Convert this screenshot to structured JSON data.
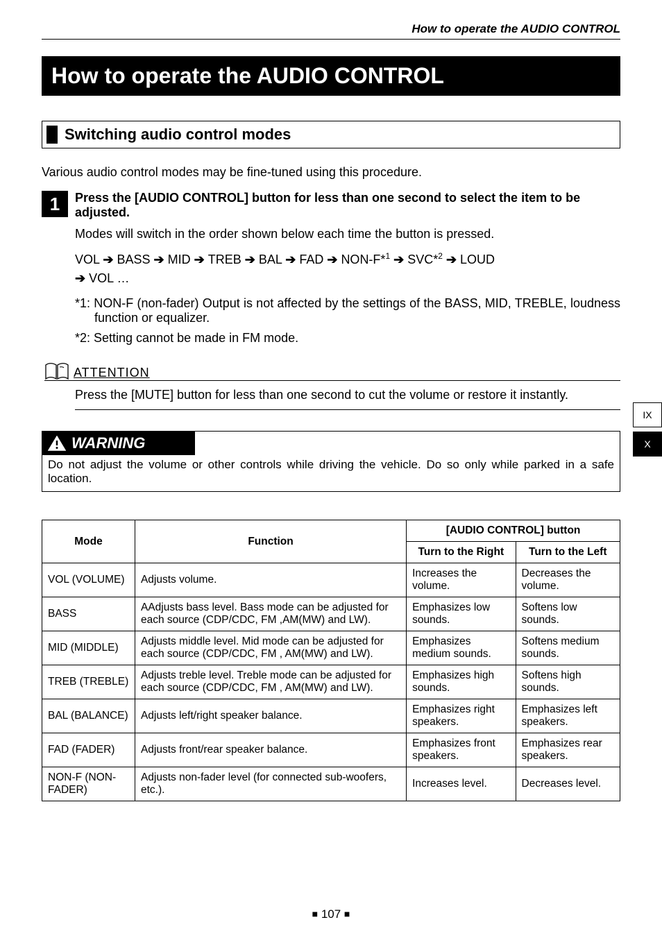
{
  "running_header": "How to operate the AUDIO CONTROL",
  "title": "How to operate the AUDIO CONTROL",
  "section_heading": "Switching audio control modes",
  "intro": "Various audio control modes may be fine-tuned using this procedure.",
  "step": {
    "num": "1",
    "lead": "Press the [AUDIO CONTROL] button for less than one second to select the item to be adjusted.",
    "text": "Modes will switch in the order shown below each time the button is pressed.",
    "chain_parts": [
      "VOL",
      "BASS",
      "MID",
      "TREB",
      "BAL",
      "FAD"
    ],
    "chain_nonf": "NON-F*",
    "chain_nonf_sup": "1",
    "chain_svc": "SVC*",
    "chain_svc_sup": "2",
    "chain_loud": "LOUD",
    "chain_tail": "VOL",
    "chain_ellipsis": "…",
    "footnotes": [
      "*1: NON-F (non-fader) Output is not affected by the settings of the BASS, MID, TREBLE, loudness function or equalizer.",
      "*2: Setting cannot be made in FM mode."
    ]
  },
  "attention": {
    "label": "ATTENTION",
    "text": "Press the [MUTE] button for less than one second to cut the volume or restore it instantly."
  },
  "warning": {
    "label": "WARNING",
    "text": "Do not adjust the volume or other controls while driving the vehicle. Do so only while parked in a safe location."
  },
  "table": {
    "col_mode": "Mode",
    "col_function": "Function",
    "col_group": "[AUDIO CONTROL] button",
    "col_right": "Turn to the Right",
    "col_left": "Turn to the Left",
    "rows": [
      {
        "mode": "VOL (VOLUME)",
        "function": "Adjusts volume.",
        "right": "Increases the volume.",
        "left": "Decreases the volume."
      },
      {
        "mode": "BASS",
        "function": "AAdjusts bass level. Bass mode can be adjusted for each source (CDP/CDC, FM ,AM(MW) and LW).",
        "right": "Emphasizes low sounds.",
        "left": "Softens low sounds."
      },
      {
        "mode": "MID (MIDDLE)",
        "function": "Adjusts middle level. Mid mode can be adjusted for each source (CDP/CDC, FM , AM(MW) and LW).",
        "right": "Emphasizes medium sounds.",
        "left": "Softens medium sounds."
      },
      {
        "mode": "TREB (TREBLE)",
        "function": "Adjusts treble level. Treble mode can be adjusted for each source (CDP/CDC, FM , AM(MW) and LW).",
        "right": "Emphasizes high sounds.",
        "left": "Softens high sounds."
      },
      {
        "mode": "BAL (BALANCE)",
        "function": "Adjusts left/right speaker balance.",
        "right": "Emphasizes right speakers.",
        "left": "Emphasizes left speakers."
      },
      {
        "mode": "FAD (FADER)",
        "function": "Adjusts front/rear speaker balance.",
        "right": "Emphasizes front speakers.",
        "left": "Emphasizes rear speakers."
      },
      {
        "mode": "NON-F (NON-FADER)",
        "function": "Adjusts non-fader level (for connected sub-woofers, etc.).",
        "right": "Increases level.",
        "left": "Decreases level."
      }
    ]
  },
  "side_tabs": [
    {
      "label": "IX",
      "active": false
    },
    {
      "label": "X",
      "active": true
    }
  ],
  "page_number": "107"
}
